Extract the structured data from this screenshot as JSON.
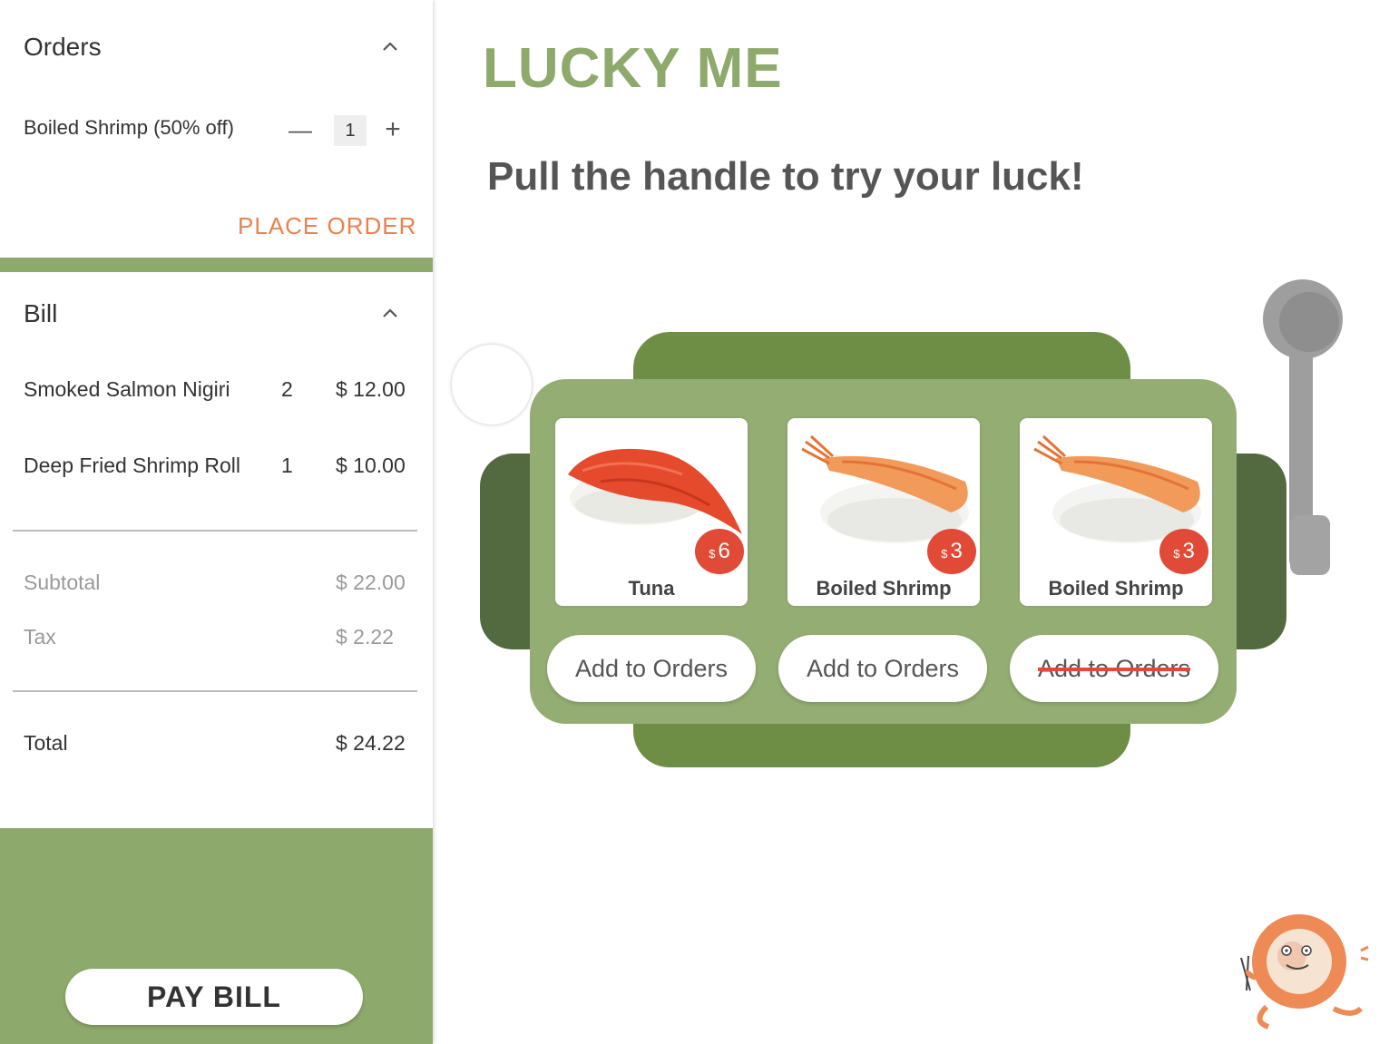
{
  "orders": {
    "title": "Orders",
    "item_name": "Boiled Shrimp (50% off)",
    "minus": "—",
    "quantity": "1",
    "plus": "+",
    "place_order": "PLACE ORDER"
  },
  "bill": {
    "title": "Bill",
    "items": [
      {
        "name": "Smoked Salmon Nigiri",
        "qty": "2",
        "price": "$ 12.00"
      },
      {
        "name": "Deep Fried Shrimp Roll",
        "qty": "1",
        "price": "$ 10.00"
      }
    ],
    "subtotal_label": "Subtotal",
    "subtotal_value": "$ 22.00",
    "tax_label": "Tax",
    "tax_value": "$ 2.22",
    "total_label": "Total",
    "total_value": "$ 24.22",
    "pay_bill": "PAY BILL"
  },
  "main": {
    "brand": "LUCKY ME",
    "tagline": "Pull the handle to try your luck!"
  },
  "slots": [
    {
      "name": "Tuna",
      "currency": "$",
      "price": "6",
      "button": "Add to Orders",
      "disabled": false
    },
    {
      "name": "Boiled Shrimp",
      "currency": "$",
      "price": "3",
      "button": "Add to Orders",
      "disabled": false
    },
    {
      "name": "Boiled Shrimp",
      "currency": "$",
      "price": "3",
      "button": "Add to Orders",
      "disabled": true
    }
  ],
  "colors": {
    "accent_green": "#8DA96B",
    "dark_green": "#6E8D45",
    "orange": "#E8834E",
    "badge_red": "#E04A36"
  },
  "icons": {
    "orders_collapse": "chevron-up-icon",
    "bill_collapse": "chevron-up-icon",
    "mascot": "sushi-mascot-icon"
  }
}
